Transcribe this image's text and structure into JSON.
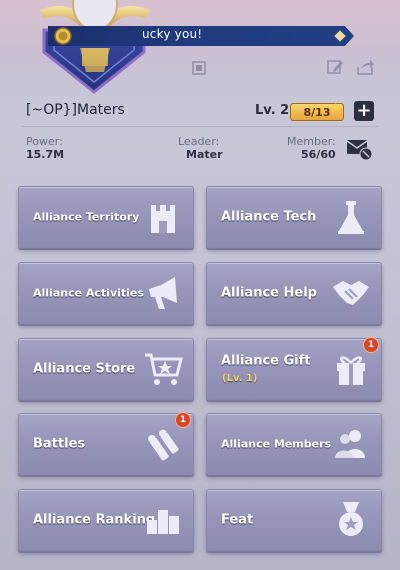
{
  "banner": {
    "text": "ucky you!"
  },
  "alliance": {
    "name": "[~OP}]Maters",
    "level_label": "Lv. 2",
    "level_progress": "8/13",
    "power_label": "Power:",
    "power_value": "15.7M",
    "leader_label": "Leader:",
    "leader_value": "Mater",
    "member_label": "Member:",
    "member_value": "56/60"
  },
  "buttons": [
    {
      "label": "Alliance Territory",
      "icon": "castle-icon"
    },
    {
      "label": "Alliance Tech",
      "icon": "flask-icon"
    },
    {
      "label": "Alliance Activities",
      "icon": "megaphone-icon"
    },
    {
      "label": "Alliance Help",
      "icon": "handshake-icon"
    },
    {
      "label": "Alliance Store",
      "icon": "cart-icon"
    },
    {
      "label": "Alliance Gift",
      "sub": "(Lv. 1)",
      "icon": "gift-icon",
      "badge": "1"
    },
    {
      "label": "Battles",
      "icon": "bullets-icon",
      "badge": "1"
    },
    {
      "label": "Alliance Members",
      "icon": "members-icon"
    },
    {
      "label": "Alliance Ranking",
      "icon": "podium-icon"
    },
    {
      "label": "Feat",
      "icon": "medal-icon"
    }
  ],
  "colors": {
    "button_bg": "#9796b9",
    "badge": "#d9472b",
    "banner": "#1f3a7d",
    "gold": "#e7a53b"
  }
}
